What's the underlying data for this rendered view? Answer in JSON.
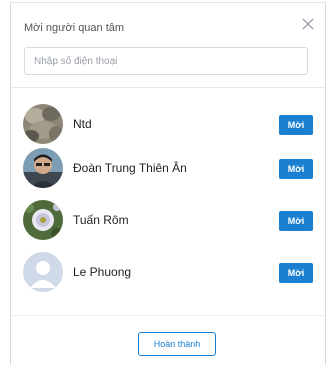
{
  "dialog": {
    "title": "Mời người quan tâm",
    "search": {
      "placeholder": "Nhập số điện thoại",
      "value": ""
    },
    "invite_label": "Mời",
    "done_label": "Hoàn thành",
    "accent": "#1a7fd0",
    "contacts": [
      {
        "name": "Ntd",
        "avatar": "photo-rocks"
      },
      {
        "name": "Đoàn Trung Thiên Ân",
        "avatar": "photo-person"
      },
      {
        "name": "Tuấn Rôm",
        "avatar": "photo-flowers"
      },
      {
        "name": "Le Phuong",
        "avatar": "default-user-icon"
      }
    ]
  }
}
